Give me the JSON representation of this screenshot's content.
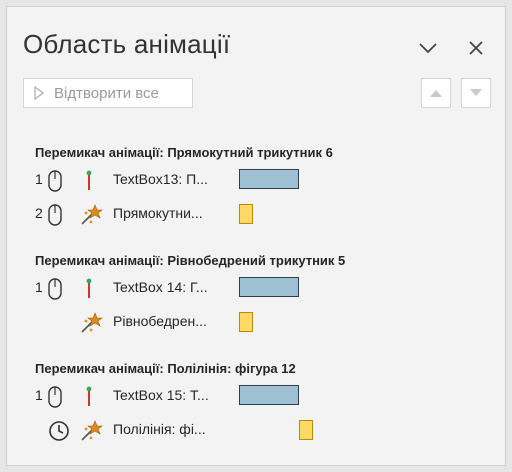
{
  "pane": {
    "title": "Область анімації",
    "collapse_icon": "chevron-down-icon",
    "close_icon": "close-icon",
    "play_all_label": "Відтворити все",
    "move_up_icon": "triangle-up-icon",
    "move_down_icon": "triangle-down-icon"
  },
  "groups": [
    {
      "title": "Перемикач анімації: Прямокутний трикутник 6",
      "items": [
        {
          "num": "1",
          "trigger": "mouse-icon",
          "effect": "appear",
          "label": "TextBox13: П..."
        },
        {
          "num": "2",
          "trigger": "mouse-icon",
          "effect": "emphasis",
          "label": "Прямокутни..."
        }
      ]
    },
    {
      "title": "Перемикач анімації: Рівнобедрений трикутник 5",
      "items": [
        {
          "num": "1",
          "trigger": "mouse-icon",
          "effect": "appear",
          "label": "TextBox 14: Г..."
        },
        {
          "num": "",
          "trigger": "",
          "effect": "emphasis",
          "label": "Рівнобедрен..."
        }
      ]
    },
    {
      "title": "Перемикач анімації: Полілінія: фігура 12",
      "items": [
        {
          "num": "1",
          "trigger": "mouse-icon",
          "effect": "appear",
          "label": "TextBox 15: Т..."
        },
        {
          "num": "",
          "trigger": "clock-icon",
          "effect": "emphasis",
          "label": "Полілінія: фі..."
        }
      ]
    }
  ],
  "colors": {
    "timeline_blue": "#9fc1d4",
    "timeline_yellow": "#ffd966",
    "effect_green": "#3aa655",
    "effect_red": "#d13438",
    "effect_orange": "#e08a1e"
  }
}
